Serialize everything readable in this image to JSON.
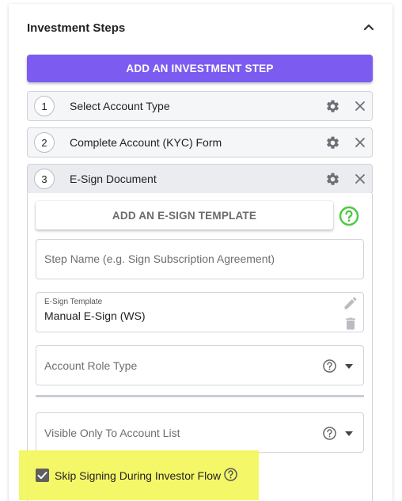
{
  "panel": {
    "title": "Investment Steps",
    "collapse_icon": "chevron-up-icon",
    "add_step_label": "ADD AN INVESTMENT STEP",
    "accent_color": "#7c5cf0"
  },
  "steps": [
    {
      "number": "1",
      "label": "Select Account Type"
    },
    {
      "number": "2",
      "label": "Complete Account (KYC) Form"
    },
    {
      "number": "3",
      "label": "E-Sign Document"
    }
  ],
  "step_editor": {
    "add_esign_label": "ADD AN E-SIGN TEMPLATE",
    "help_color": "#4cc93f",
    "step_name_placeholder": "Step Name (e.g. Sign Subscription Agreement)",
    "esign_template_label": "E-Sign Template",
    "esign_template_value": "Manual E-Sign (WS)",
    "account_role_placeholder": "Account Role Type",
    "visible_only_placeholder": "Visible Only To Account List",
    "skip_signing_label": "Skip Signing During Investor Flow",
    "skip_signing_checked": true
  }
}
